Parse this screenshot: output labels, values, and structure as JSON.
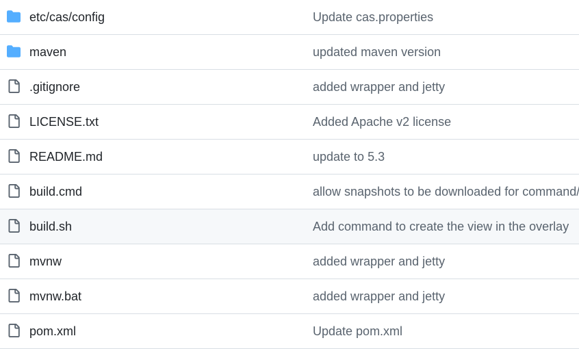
{
  "files": [
    {
      "name": "etc/cas/config",
      "type": "folder",
      "icon": "folder-icon",
      "message": "Update cas.properties"
    },
    {
      "name": "maven",
      "type": "folder",
      "icon": "folder-icon",
      "message": "updated maven version"
    },
    {
      "name": ".gitignore",
      "type": "file",
      "icon": "file-icon",
      "message": "added wrapper and jetty"
    },
    {
      "name": "LICENSE.txt",
      "type": "file",
      "icon": "file-icon",
      "message": "Added Apache v2 license"
    },
    {
      "name": "README.md",
      "type": "file",
      "icon": "file-icon",
      "message": "update to 5.3"
    },
    {
      "name": "build.cmd",
      "type": "file",
      "icon": "file-icon",
      "message": "allow snapshots to be downloaded for command/c"
    },
    {
      "name": "build.sh",
      "type": "file",
      "icon": "file-icon",
      "message": "Add command to create the view in the overlay"
    },
    {
      "name": "mvnw",
      "type": "file",
      "icon": "file-icon",
      "message": "added wrapper and jetty"
    },
    {
      "name": "mvnw.bat",
      "type": "file",
      "icon": "file-icon",
      "message": "added wrapper and jetty"
    },
    {
      "name": "pom.xml",
      "type": "file",
      "icon": "file-icon",
      "message": "Update pom.xml"
    }
  ],
  "colors": {
    "folder": "#54aeff",
    "file_icon": "#59636e",
    "filename": "#1f2328",
    "message": "#59636e",
    "hover_row": "#f6f8fa",
    "divider": "#d8dee4"
  }
}
